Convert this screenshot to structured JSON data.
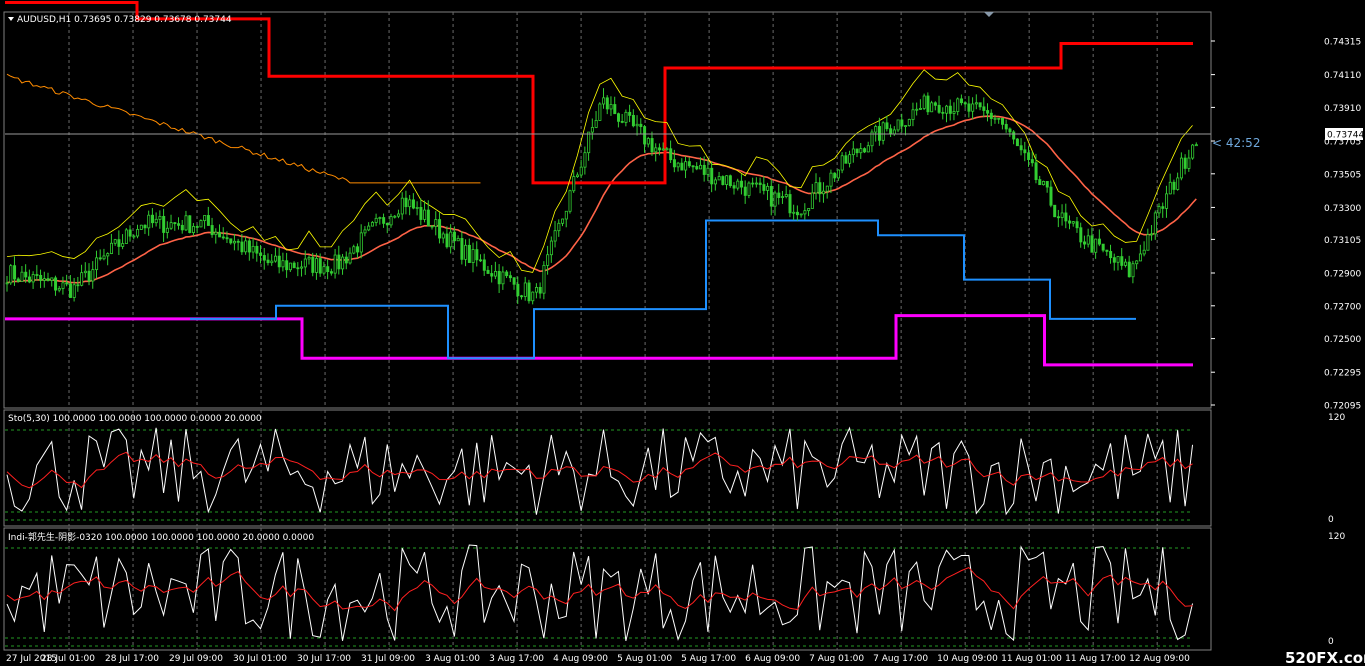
{
  "symbol_header": "AUDUSD,H1  0.73695 0.73829 0.73678 0.73744",
  "countdown": "< 42:52",
  "watermark": "520FX.com",
  "colors": {
    "background": "#000000",
    "candles": "#32cd32",
    "grid": "#6a6a6a",
    "resistance": "#ff0000",
    "support_magenta": "#ff00ff",
    "support_blue": "#1e90ff",
    "ma_red": "#ff6347",
    "orange_line": "#ff8c00",
    "yellow_line": "#ffff00",
    "osc_main": "#ffffff",
    "osc_signal": "#ff2020",
    "level_lines": "#32cd32"
  },
  "main_panel": {
    "price_ticks": [
      "0.74315",
      "0.74110",
      "0.73910",
      "0.73705",
      "0.73505",
      "0.73300",
      "0.73105",
      "0.72900",
      "0.72700",
      "0.72500",
      "0.72295",
      "0.72095"
    ],
    "current_price": "0.73744"
  },
  "time_axis": {
    "labels": [
      "27 Jul 2015",
      "28 Jul 01:00",
      "28 Jul 17:00",
      "29 Jul 09:00",
      "30 Jul 01:00",
      "30 Jul 17:00",
      "31 Jul 09:00",
      "3 Aug 01:00",
      "3 Aug 17:00",
      "4 Aug 09:00",
      "5 Aug 01:00",
      "5 Aug 17:00",
      "6 Aug 09:00",
      "7 Aug 01:00",
      "7 Aug 17:00",
      "10 Aug 09:00",
      "11 Aug 01:00",
      "11 Aug 17:00",
      "12 Aug 09:00"
    ]
  },
  "indicator1": {
    "header": "Sto(5,30) 100.0000 100.0000 100.0000 0.0000 20.0000",
    "scale_top": "120",
    "scale_bottom": "0"
  },
  "indicator2": {
    "header": "Indi-郭先生-阴影-0320 100.0000 100.0000 100.0000 20.0000 0.0000",
    "scale_top": "120",
    "scale_bottom": "0"
  },
  "chart_data": {
    "type": "line",
    "title": "AUDUSD,H1",
    "ylim": [
      0.72095,
      0.74315
    ],
    "x": [
      "27 Jul 2015",
      "28 Jul 01:00",
      "28 Jul 17:00",
      "29 Jul 09:00",
      "30 Jul 01:00",
      "30 Jul 17:00",
      "31 Jul 09:00",
      "3 Aug 01:00",
      "3 Aug 17:00",
      "4 Aug 09:00",
      "5 Aug 01:00",
      "5 Aug 17:00",
      "6 Aug 09:00",
      "7 Aug 01:00",
      "7 Aug 17:00",
      "10 Aug 09:00",
      "11 Aug 01:00",
      "11 Aug 17:00",
      "12 Aug 09:00"
    ],
    "series": [
      {
        "name": "",
        "values": [
          0.729,
          0.728,
          0.732,
          0.732,
          0.7295,
          0.7295,
          0.7335,
          0.73,
          0.7275,
          0.7395,
          0.736,
          0.7345,
          0.733,
          0.737,
          0.7395,
          0.7385,
          0.732,
          0.729,
          0.7374
        ]
      }
    ],
    "resistance_steps": [
      0.7455,
      0.7445,
      0.741,
      0.741,
      0.7345,
      0.7415,
      0.7415,
      0.7415,
      0.743
    ],
    "support_steps": [
      0.7262,
      0.7262,
      0.7238,
      0.7238,
      0.7238,
      0.7238,
      0.7264,
      0.7234
    ]
  }
}
